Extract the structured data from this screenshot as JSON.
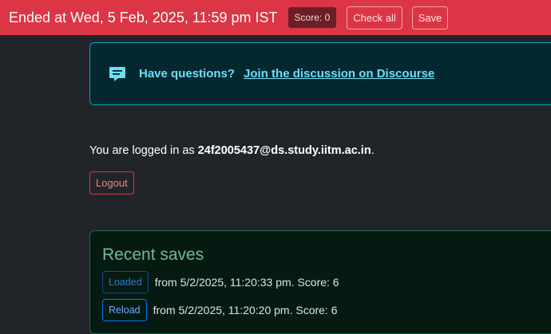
{
  "header": {
    "status_text": "Ended at Wed, 5 Feb, 2025, 11:59 pm IST",
    "score_badge": "Score: 0",
    "check_all_label": "Check all",
    "save_label": "Save",
    "accent_color": "#dc3545"
  },
  "discourse": {
    "icon": "chat-bubble-icon",
    "question": "Have questions?",
    "link_text": "Join the discussion on Discourse"
  },
  "login": {
    "prefix": "You are logged in as ",
    "email": "24f2005437@ds.study.iitm.ac.in",
    "suffix": ".",
    "logout_label": "Logout"
  },
  "recent_saves": {
    "title": "Recent saves",
    "items": [
      {
        "button": "Loaded",
        "text": "from 5/2/2025, 11:20:33 pm. Score: 6"
      },
      {
        "button": "Reload",
        "text": "from 5/2/2025, 11:20:20 pm. Score: 6"
      }
    ]
  }
}
